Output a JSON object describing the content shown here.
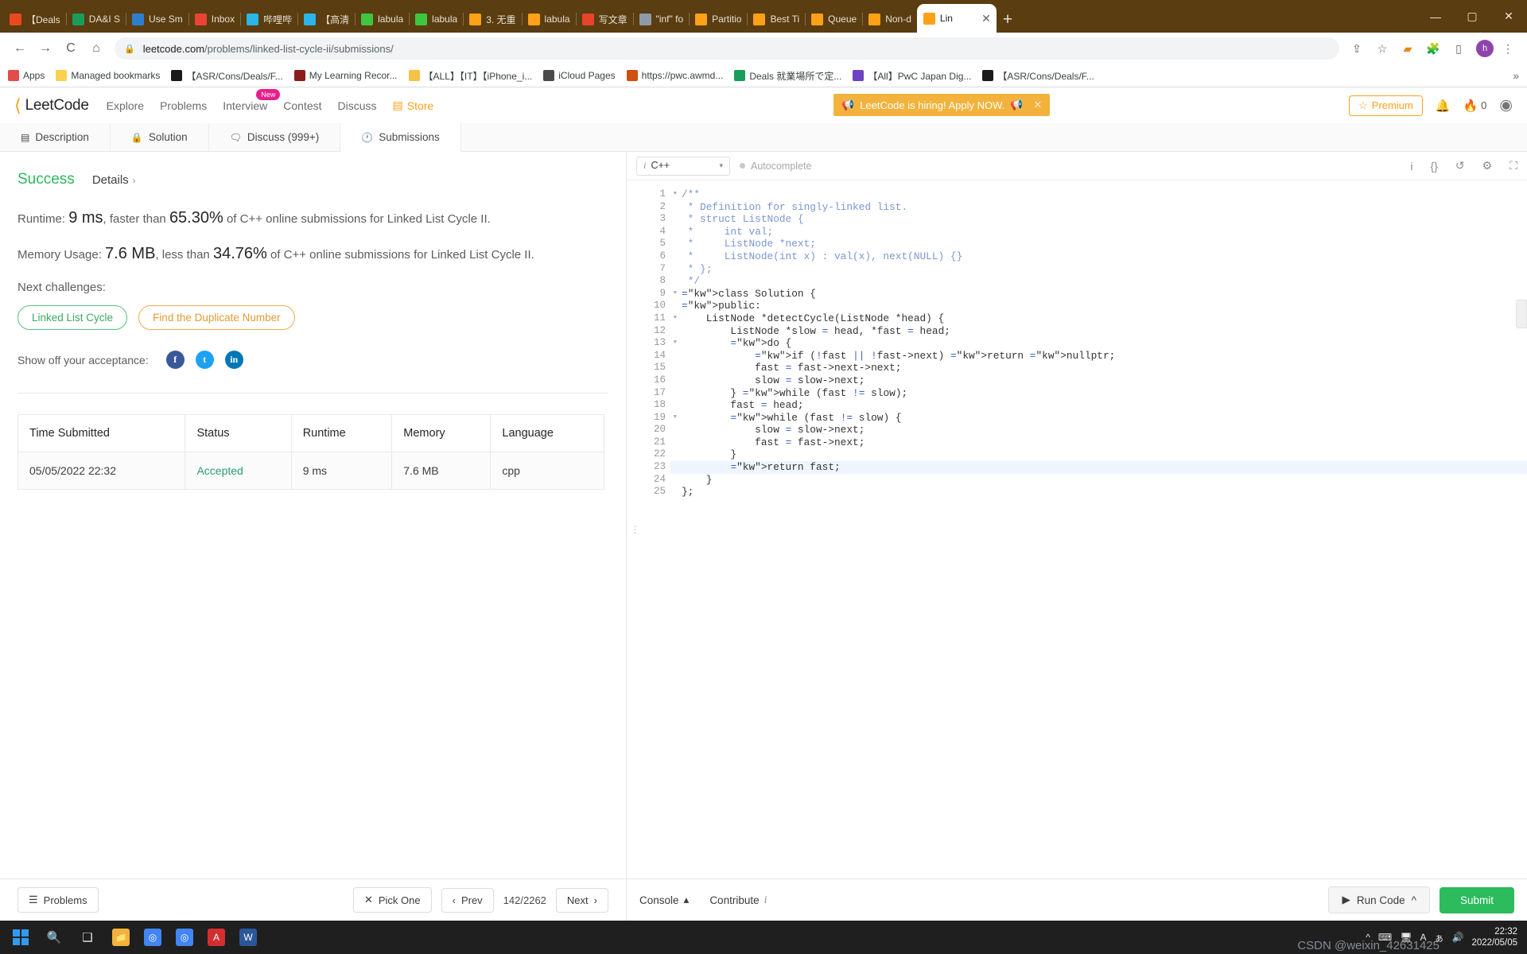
{
  "browser": {
    "tabs": [
      {
        "label": "【Deals",
        "color": "#e8491d"
      },
      {
        "label": "DA&I S",
        "color": "#1a9c5b"
      },
      {
        "label": "Use Sm",
        "color": "#2f7fd1"
      },
      {
        "label": "Inbox",
        "color": "#ea4335"
      },
      {
        "label": "哔哩哔",
        "color": "#2bb5e8"
      },
      {
        "label": "【高清",
        "color": "#2bb5e8"
      },
      {
        "label": "labula",
        "color": "#3ec63e"
      },
      {
        "label": "labula",
        "color": "#3ec63e"
      },
      {
        "label": "3. 无重",
        "color": "#ffa116"
      },
      {
        "label": "labula",
        "color": "#ffa116"
      },
      {
        "label": "写文章",
        "color": "#e8432c"
      },
      {
        "label": "\"inf\" fo",
        "color": "#8e9aa8"
      },
      {
        "label": "Partitio",
        "color": "#ffa116"
      },
      {
        "label": "Best Ti",
        "color": "#ffa116"
      },
      {
        "label": "Queue",
        "color": "#ffa116"
      },
      {
        "label": "Non-d",
        "color": "#ffa116"
      },
      {
        "label": "Lin",
        "color": "#ffa116",
        "active": true
      }
    ],
    "new_tab_label": "+",
    "window_controls": [
      "—",
      "▢",
      "✕"
    ],
    "nav": {
      "back": "←",
      "forward": "→",
      "reload": "C",
      "home": "⌂",
      "lock_icon": "lock-icon",
      "url_domain": "leetcode.com",
      "url_path": "/problems/linked-list-cycle-ii/submissions/",
      "share_icon": "share-icon",
      "star_icon": "star-icon",
      "ext1_icon": "extension-puzzle-icon",
      "ext2_icon": "sidepanel-icon",
      "menu_icon": "kebab-menu-icon",
      "profile_initial": "h"
    },
    "bookmarks": [
      {
        "label": "Apps",
        "color": "#e54b4b"
      },
      {
        "label": "Managed bookmarks",
        "color": "#fbd14b"
      },
      {
        "label": "【ASR/Cons/Deals/F...",
        "color": "#1a1a1a"
      },
      {
        "label": "My Learning Recor...",
        "color": "#8c1d1d"
      },
      {
        "label": "【ALL】【IT】【iPhone_i...",
        "color": "#f5c243"
      },
      {
        "label": "iCloud Pages",
        "color": "#4a4a4a"
      },
      {
        "label": "https://pwc.awmd...",
        "color": "#d2500f"
      },
      {
        "label": "Deals 就業場所で定...",
        "color": "#1a9c5b"
      },
      {
        "label": "【All】PwC Japan Dig...",
        "color": "#6f42c1"
      },
      {
        "label": "【ASR/Cons/Deals/F...",
        "color": "#1a1a1a"
      }
    ],
    "bookmark_overflow": "»"
  },
  "leetcode": {
    "logo_text": "LeetCode",
    "nav": [
      {
        "label": "Explore"
      },
      {
        "label": "Problems"
      },
      {
        "label": "Interview",
        "badge": "New"
      },
      {
        "label": "Contest"
      },
      {
        "label": "Discuss"
      },
      {
        "label": "Store",
        "accent": true
      }
    ],
    "hiring_banner": {
      "text": "LeetCode is hiring! Apply NOW.",
      "speaker_icon": "speaker-icon",
      "close_icon": "close-icon"
    },
    "premium_label": "Premium",
    "premium_star": "☆",
    "bell_icon": "bell-icon",
    "streak_icon": "fire-icon",
    "streak_count": "0",
    "account_icon": "account-circle-icon",
    "accent_color": "#ffa116",
    "success_color": "#2cbb5d"
  },
  "problem_tabs": [
    {
      "label": "Description",
      "icon": "document-icon"
    },
    {
      "label": "Solution",
      "icon": "lock-icon"
    },
    {
      "label": "Discuss (999+)",
      "icon": "comment-icon"
    },
    {
      "label": "Submissions",
      "icon": "clock-icon",
      "active": true
    }
  ],
  "result": {
    "status": "Success",
    "details_label": "Details",
    "details_chevron": "›",
    "runtime": {
      "prefix": "Runtime:",
      "value": "9 ms",
      "mid": ", faster than",
      "percent": "65.30%",
      "suffix": "of C++ online submissions for Linked List Cycle II."
    },
    "memory": {
      "prefix": "Memory Usage:",
      "value": "7.6 MB",
      "mid": ", less than",
      "percent": "34.76%",
      "suffix": "of C++ online submissions for Linked List Cycle II."
    },
    "next_challenges_label": "Next challenges:",
    "next_challenges": [
      {
        "label": "Linked List Cycle",
        "style": "green"
      },
      {
        "label": "Find the Duplicate Number",
        "style": "orange"
      }
    ],
    "share_label": "Show off your acceptance:",
    "share_buttons": [
      {
        "name": "facebook-share-icon",
        "glyph": "f",
        "style": "fb"
      },
      {
        "name": "twitter-share-icon",
        "glyph": "t",
        "style": "tw"
      },
      {
        "name": "linkedin-share-icon",
        "glyph": "in",
        "style": "li"
      }
    ]
  },
  "submissions_table": {
    "headers": [
      "Time Submitted",
      "Status",
      "Runtime",
      "Memory",
      "Language"
    ],
    "rows": [
      [
        "05/05/2022 22:32",
        "Accepted",
        "9 ms",
        "7.6 MB",
        "cpp"
      ]
    ]
  },
  "left_footer": {
    "problems_label": "Problems",
    "problems_icon": "list-icon",
    "pick_one_label": "Pick One",
    "pick_one_icon": "shuffle-icon",
    "prev_label": "Prev",
    "prev_icon": "chevron-left-icon",
    "counter": "142/2262",
    "next_label": "Next",
    "next_icon": "chevron-right-icon"
  },
  "editor": {
    "lang_prefix": "i",
    "language": "C++",
    "caret": "▾",
    "autocomplete_label": "Autocomplete",
    "tools": [
      {
        "name": "info-icon",
        "glyph": "i"
      },
      {
        "name": "format-braces-icon",
        "glyph": "{}"
      },
      {
        "name": "undo-icon",
        "glyph": "↺"
      },
      {
        "name": "settings-icon",
        "glyph": "⚙"
      },
      {
        "name": "fullscreen-icon",
        "glyph": "⛶"
      }
    ],
    "line_numbers": [
      1,
      2,
      3,
      4,
      5,
      6,
      7,
      8,
      9,
      10,
      11,
      12,
      13,
      14,
      15,
      16,
      17,
      18,
      19,
      20,
      21,
      22,
      23,
      24,
      25
    ],
    "fold_lines": [
      1,
      9,
      11,
      13,
      19
    ],
    "highlighted_line": 23,
    "code_lines": [
      "/**",
      " * Definition for singly-linked list.",
      " * struct ListNode {",
      " *     int val;",
      " *     ListNode *next;",
      " *     ListNode(int x) : val(x), next(NULL) {}",
      " * };",
      " */",
      "class Solution {",
      "public:",
      "    ListNode *detectCycle(ListNode *head) {",
      "        ListNode *slow = head, *fast = head;",
      "        do {",
      "            if (!fast || !fast->next) return nullptr;",
      "            fast = fast->next->next;",
      "            slow = slow->next;",
      "        } while (fast != slow);",
      "        fast = head;",
      "        while (fast != slow) {",
      "            slow = slow->next;",
      "            fast = fast->next;",
      "        }",
      "        return fast;",
      "    }",
      "};"
    ]
  },
  "right_footer": {
    "console_label": "Console",
    "console_caret": "▴",
    "contribute_label": "Contribute",
    "contribute_icon": "info-italic-icon",
    "run_label": "Run Code",
    "run_icon": "play-icon",
    "run_caret": "^",
    "submit_label": "Submit"
  },
  "taskbar": {
    "start_icon": "windows-start-icon",
    "search_icon": "search-icon",
    "taskview_icon": "task-view-icon",
    "apps": [
      {
        "name": "file-explorer-icon",
        "color": "#f2b23c",
        "glyph": "📁"
      },
      {
        "name": "chrome-icon",
        "color": "#4285f4",
        "glyph": "◎"
      },
      {
        "name": "chrome-active-icon",
        "color": "#4285f4",
        "glyph": "◎"
      },
      {
        "name": "acrobat-icon",
        "color": "#d32f2f",
        "glyph": "A"
      },
      {
        "name": "word-icon",
        "color": "#2b579a",
        "glyph": "W"
      }
    ],
    "tray": [
      {
        "name": "show-hidden-icons",
        "glyph": "^"
      },
      {
        "name": "keyboard-icon",
        "glyph": "⌨"
      },
      {
        "name": "monitor-icon",
        "glyph": "🖥"
      },
      {
        "name": "ime-icon",
        "glyph": "ぁ"
      },
      {
        "name": "volume-icon",
        "glyph": "🔊"
      }
    ],
    "ime_label": "A",
    "clock_time": "22:32",
    "clock_date": "2022/05/05",
    "watermark": "CSDN @weixin_42631425"
  }
}
